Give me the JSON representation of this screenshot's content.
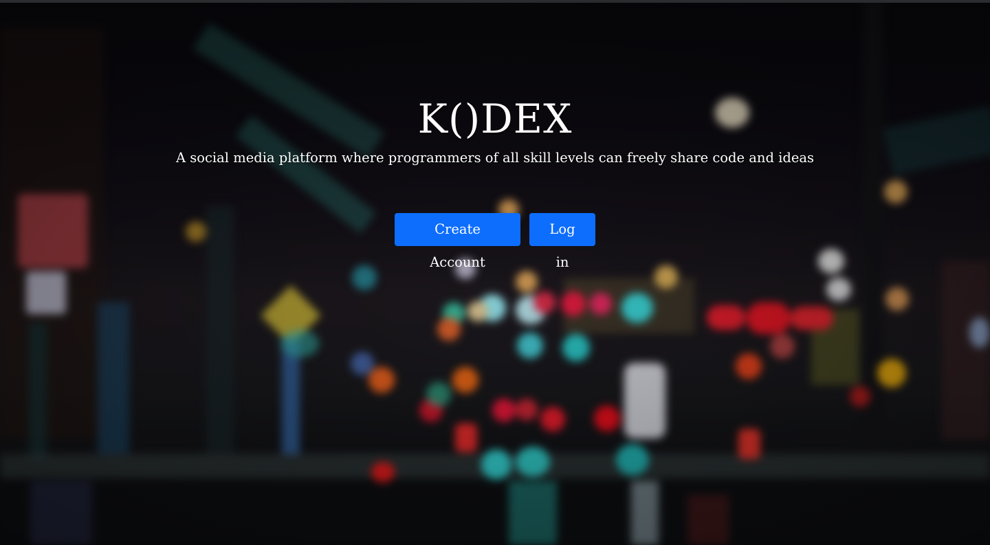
{
  "hero": {
    "title": "K()DEX",
    "tagline": "A social media platform where programmers of all skill levels can freely share code and ideas"
  },
  "actions": {
    "create_account_label": "Create Account",
    "login_label": "Log in"
  },
  "colors": {
    "button_primary": "#0d6efd",
    "text": "#ffffff",
    "background": "#0b0b10"
  }
}
